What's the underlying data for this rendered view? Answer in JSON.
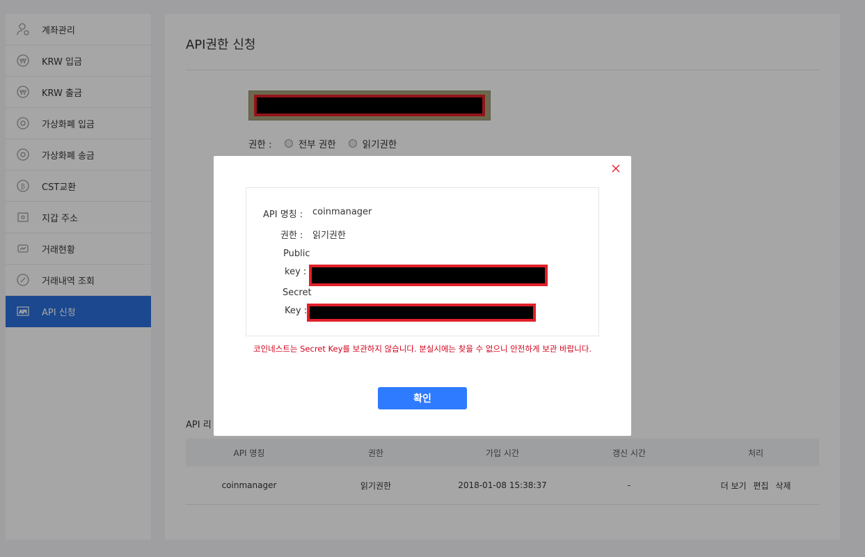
{
  "sidebar": {
    "items": [
      {
        "label": "계좌관리",
        "icon": "user-icon"
      },
      {
        "label": "KRW 입금",
        "icon": "krw-deposit-icon"
      },
      {
        "label": "KRW 출금",
        "icon": "krw-withdraw-icon"
      },
      {
        "label": "가상화폐 입금",
        "icon": "crypto-deposit-icon"
      },
      {
        "label": "가상화폐 송금",
        "icon": "crypto-send-icon"
      },
      {
        "label": "CST교환",
        "icon": "cst-exchange-icon"
      },
      {
        "label": "지갑 주소",
        "icon": "wallet-icon"
      },
      {
        "label": "거래현황",
        "icon": "trade-status-icon"
      },
      {
        "label": "거래내역 조회",
        "icon": "history-icon"
      },
      {
        "label": "API 신청",
        "icon": "api-icon",
        "active": true
      }
    ]
  },
  "main": {
    "title": "API권한 신청",
    "permission_label": "권한 :",
    "permission_options": [
      "전부 권한",
      "읽기권한"
    ],
    "list_title": "API 리",
    "table": {
      "headers": [
        "API 명칭",
        "권한",
        "가입 시간",
        "갱신 시간",
        "처리"
      ],
      "rows": [
        {
          "name": "coinmanager",
          "permission": "읽기권한",
          "joined": "2018-01-08 15:38:37",
          "updated": "-",
          "actions": [
            "더 보기",
            "편집",
            "삭제"
          ]
        }
      ]
    }
  },
  "modal": {
    "api_name_label": "API 명칭 :",
    "api_name_value": "coinmanager",
    "permission_label": "권한 :",
    "permission_value": "읽기권한",
    "public_label_1": "Public",
    "public_label_2": "key :",
    "secret_label_1": "Secret",
    "secret_label_2": "Key :",
    "warning": "코인네스트는 Secret Key를 보관하지 않습니다. 분실시에는 찾을 수 없으니 안전하게 보관 바랍니다.",
    "confirm_label": "확인"
  },
  "colors": {
    "accent": "#2a6fdb",
    "confirm": "#2f7bff",
    "warning": "#d0021b",
    "redaction_border": "#e0202a"
  }
}
